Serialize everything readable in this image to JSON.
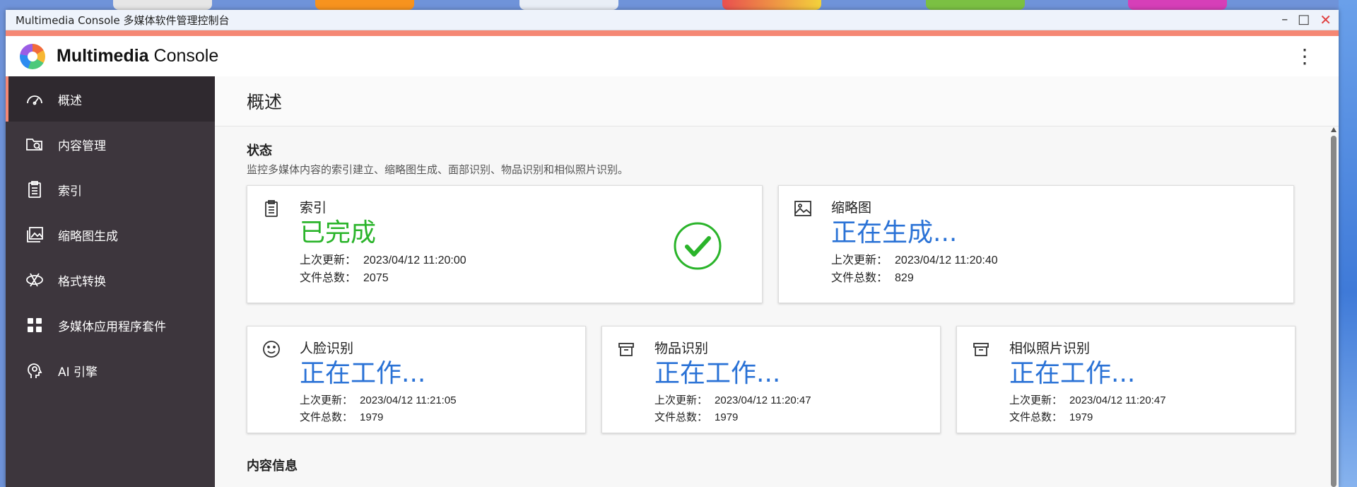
{
  "window": {
    "title": "Multimedia Console 多媒体软件管理控制台",
    "minimize_label": "–",
    "maximize_label": "□",
    "close_label": "✕"
  },
  "app": {
    "brand_bold": "Multimedia",
    "brand_regular": " Console",
    "more_icon": "⋮"
  },
  "colors": {
    "accent": "#f58774",
    "sidebar_bg": "#3d363d",
    "status_done": "#2ab42a",
    "status_working": "#2a72d6"
  },
  "sidebar": {
    "items": [
      {
        "label": "概述",
        "icon": "speedometer-icon",
        "active": true
      },
      {
        "label": "内容管理",
        "icon": "folder-search-icon"
      },
      {
        "label": "索引",
        "icon": "clipboard-icon"
      },
      {
        "label": "缩略图生成",
        "icon": "images-icon"
      },
      {
        "label": "格式转换",
        "icon": "convert-icon"
      },
      {
        "label": "多媒体应用程序套件",
        "icon": "apps-grid-icon"
      },
      {
        "label": "AI 引擎",
        "icon": "ai-head-icon"
      }
    ]
  },
  "page": {
    "title": "概述",
    "status_section": {
      "title": "状态",
      "desc": "监控多媒体内容的索引建立、缩略图生成、面部识别、物品识别和相似照片识别。"
    },
    "info_section": {
      "title": "内容信息"
    }
  },
  "cards": {
    "index": {
      "title": "索引",
      "status": "已完成",
      "updated_label": "上次更新：",
      "updated": "2023/04/12 11:20:00",
      "total_label": "文件总数：",
      "total": "2075"
    },
    "thumb": {
      "title": "缩略图",
      "status": "正在生成...",
      "updated_label": "上次更新：",
      "updated": "2023/04/12 11:20:40",
      "total_label": "文件总数：",
      "total": "829"
    },
    "face": {
      "title": "人脸识别",
      "status": "正在工作...",
      "updated_label": "上次更新：",
      "updated": "2023/04/12 11:21:05",
      "total_label": "文件总数：",
      "total": "1979"
    },
    "object": {
      "title": "物品识别",
      "status": "正在工作...",
      "updated_label": "上次更新：",
      "updated": "2023/04/12 11:20:47",
      "total_label": "文件总数：",
      "total": "1979"
    },
    "similar": {
      "title": "相似照片识别",
      "status": "正在工作...",
      "updated_label": "上次更新：",
      "updated": "2023/04/12 11:20:47",
      "total_label": "文件总数：",
      "total": "1979"
    }
  }
}
